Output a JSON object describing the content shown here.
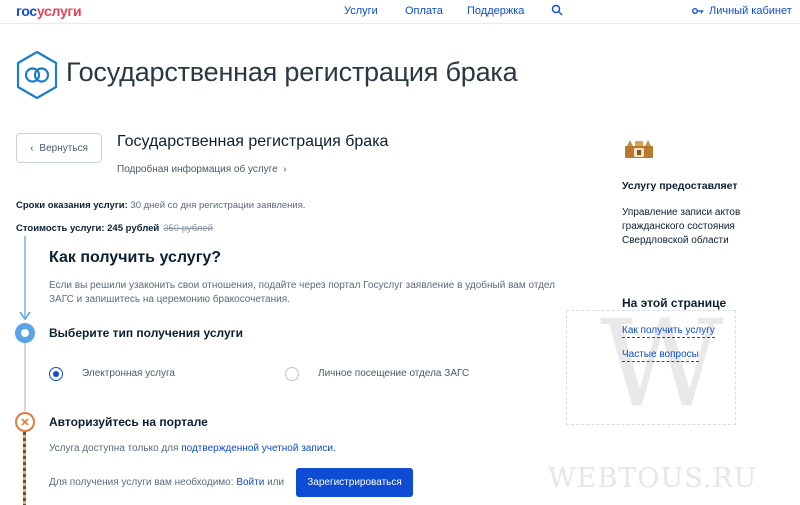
{
  "header": {
    "logo_part1": "гос",
    "logo_part2": "услуги",
    "nav": [
      "Услуги",
      "Оплата",
      "Поддержка"
    ],
    "cabinet": "Личный кабинет"
  },
  "hero": {
    "title": "Государственная регистрация брака"
  },
  "service": {
    "back_label": "Вернуться",
    "title": "Государственная регистрация брака",
    "info_link": "Подробная информация об услуге",
    "terms_label": "Сроки оказания услуги:",
    "terms_value": "30 дней со дня регистрации заявления.",
    "cost_label": "Стоимость услуги: 245 рублей",
    "cost_old": "350 рублей"
  },
  "how": {
    "title": "Как получить услугу?",
    "text": "Если вы решили узаконить свои отношения, подайте через портал Госуслуг заявление в удобный вам отдел ЗАГС и запишитесь на церемонию бракосочетания."
  },
  "step1": {
    "title": "Выберите тип получения услуги",
    "options": [
      "Электронная услуга",
      "Личное посещение отдела ЗАГС"
    ],
    "selected": "Электронная услуга"
  },
  "step2": {
    "title": "Авторизуйтесь на портале",
    "avail_text": "Услуга доступна только для",
    "avail_link": "подтвержденной учетной записи.",
    "need_text": "Для получения услуги вам необходимо:",
    "login_link": "Войти",
    "or_text": "или",
    "register_button": "Зарегистрироваться"
  },
  "sidebar": {
    "provider_title": "Услугу предоставляет",
    "provider_name": "Управление записи актов гражданского состояния Свердловской области",
    "toc_title": "На этой странице",
    "toc_links": [
      "Как получить услугу",
      "Частые вопросы"
    ]
  },
  "watermark": {
    "letter": "W",
    "text": "WEBTOUS.RU"
  },
  "colors": {
    "brand_blue": "#0d4cd3",
    "brand_red": "#ee3f58",
    "timeline": "#5aa3e6"
  }
}
